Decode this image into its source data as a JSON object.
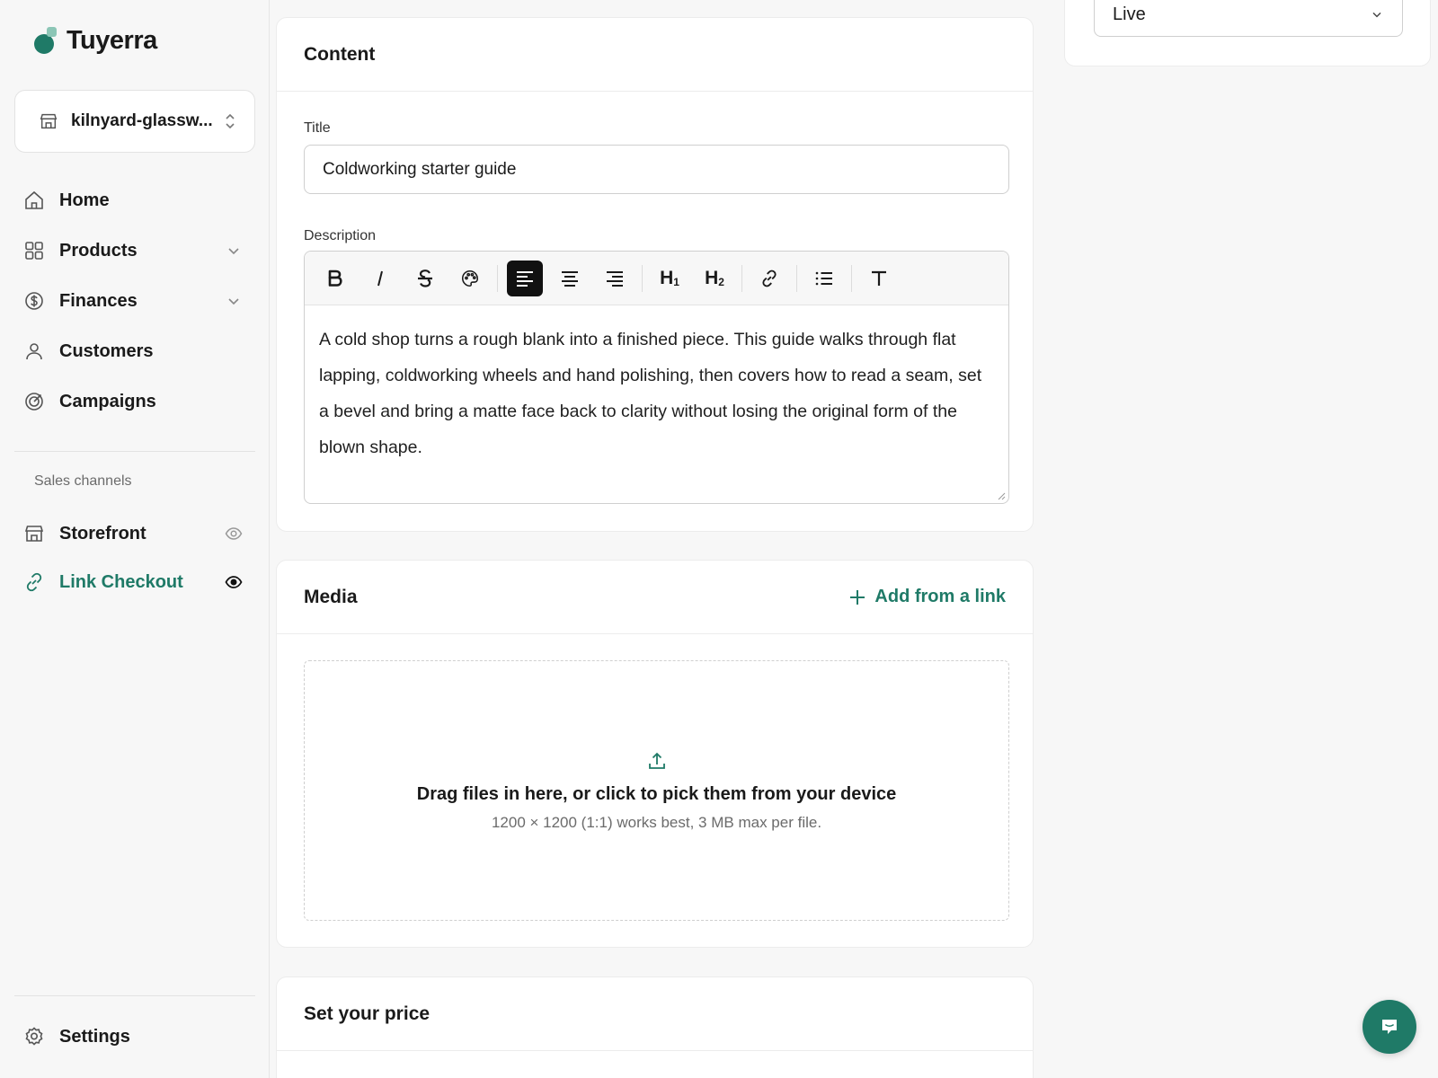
{
  "brand": {
    "name": "Tuyerra",
    "accent": "#1f7a67"
  },
  "store_switcher": {
    "label": "kilnyard-glassw..."
  },
  "nav": {
    "items": [
      {
        "label": "Home",
        "icon": "home-icon"
      },
      {
        "label": "Products",
        "icon": "grid-icon"
      },
      {
        "label": "Finances",
        "icon": "dollar-circle-icon"
      },
      {
        "label": "Customers",
        "icon": "user-icon"
      },
      {
        "label": "Campaigns",
        "icon": "target-icon"
      }
    ],
    "sales_channels_label": "Sales channels",
    "channels": [
      {
        "label": "Storefront",
        "icon": "store-icon"
      },
      {
        "label": "Link Checkout",
        "icon": "link-icon"
      }
    ],
    "settings_label": "Settings"
  },
  "content_card": {
    "heading": "Content",
    "title_label": "Title",
    "title_value": "Coldworking starter guide",
    "description_label": "Description",
    "description_text": "A cold shop turns a rough blank into a finished piece. This guide walks through flat lapping, coldworking wheels and hand polishing, then covers how to read a seam, set a bevel and bring a matte face back to clarity without losing the original form of the blown shape.",
    "toolbar": {
      "h1": "H",
      "h1_sub": "1",
      "h2": "H",
      "h2_sub": "2"
    }
  },
  "media_card": {
    "heading": "Media",
    "add_link_label": "Add from a link",
    "dropzone_main": "Drag files in here, or click to pick them from your device",
    "dropzone_sub": "1200 × 1200 (1:1) works best, 3 MB max per file."
  },
  "price_card": {
    "heading": "Set your price"
  },
  "status": {
    "value": "Live"
  }
}
